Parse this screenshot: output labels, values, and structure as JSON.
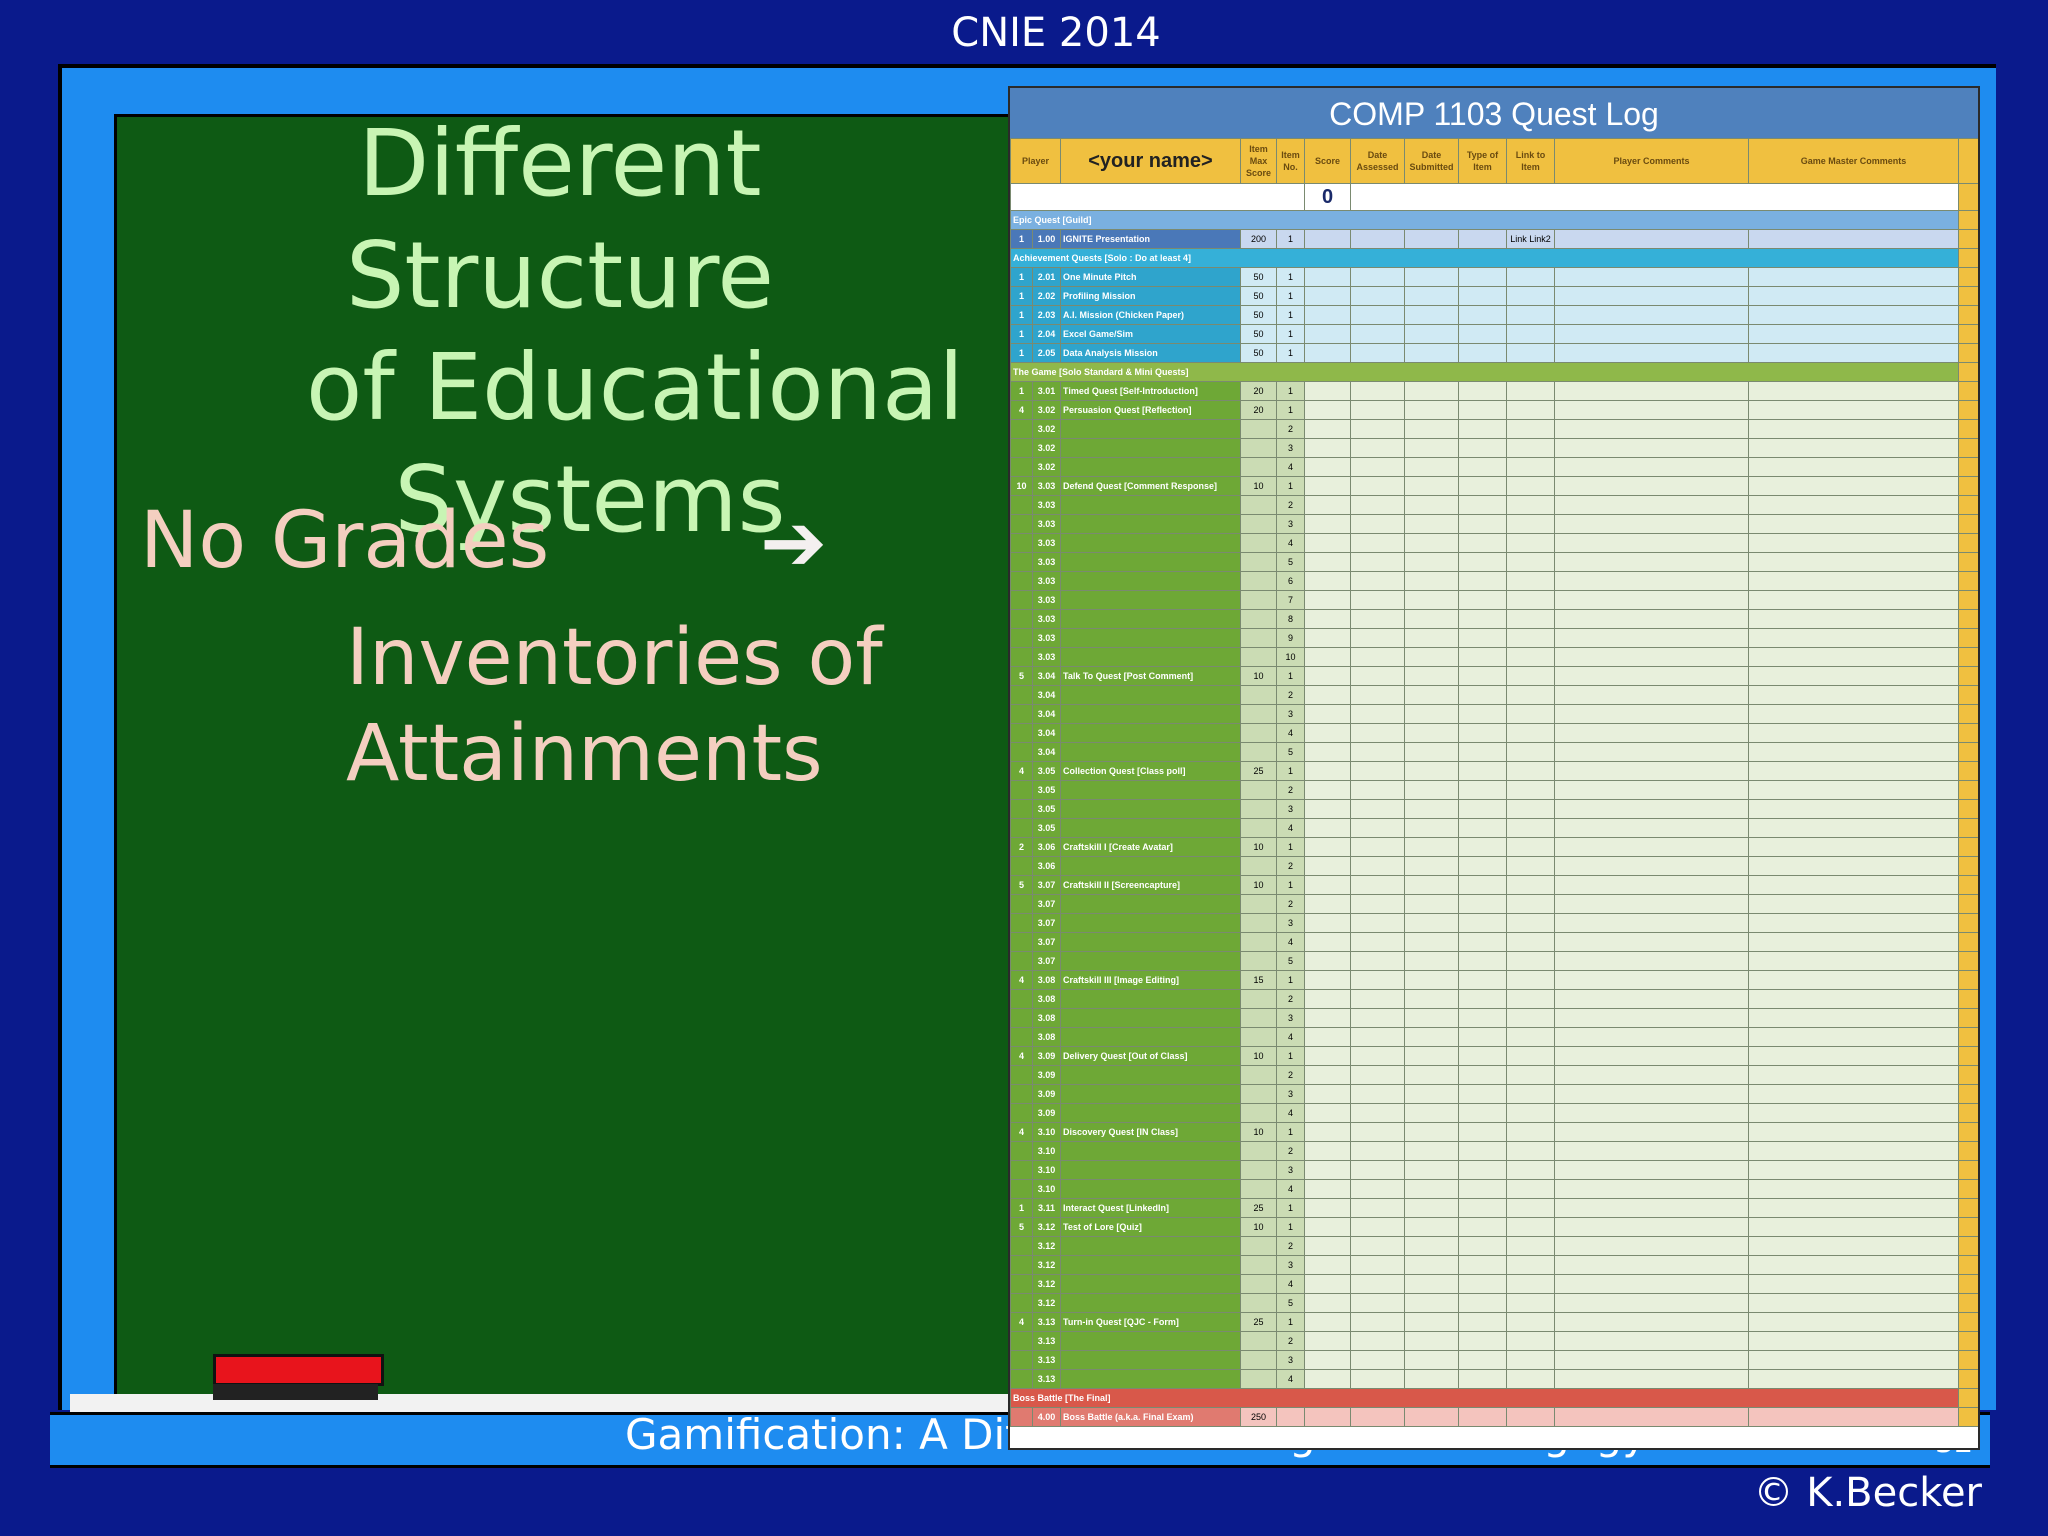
{
  "header": {
    "conference": "CNIE 2014"
  },
  "slide": {
    "title_line1": "Different Structure",
    "title_line2": "of Educational",
    "title_line3": "Systems",
    "left_text": "No Grades",
    "arrow_glyph": "➔",
    "right_text_line1": "Inventories of",
    "right_text_line2": "Attainments"
  },
  "footer": {
    "text": "Gamification: A Different Paradigm for Pedagogy",
    "page": "32",
    "copyright": "© K.Becker"
  },
  "sheet": {
    "title": "COMP 1103 Quest Log",
    "headers": [
      "Player",
      "<your name>",
      "Item Max Score",
      "Item No.",
      "Score",
      "Date Assessed",
      "Date Submitted",
      "Type of Item",
      "Link to Item",
      "Player Comments",
      "Game Master Comments"
    ],
    "score_total": "0",
    "sections": [
      {
        "title": "Epic Quest [Guild]",
        "style": "E",
        "rows": [
          {
            "p": "1",
            "id": "1.00",
            "name": "IGNITE Presentation",
            "max": "200",
            "no": "1",
            "link": "Link Link2"
          }
        ]
      },
      {
        "title": "Achievement Quests [Solo : Do at least 4]",
        "style": "A",
        "rows": [
          {
            "p": "1",
            "id": "2.01",
            "name": "One Minute Pitch",
            "max": "50",
            "no": "1"
          },
          {
            "p": "1",
            "id": "2.02",
            "name": "Profiling Mission",
            "max": "50",
            "no": "1"
          },
          {
            "p": "1",
            "id": "2.03",
            "name": "A.I. Mission (Chicken Paper)",
            "max": "50",
            "no": "1"
          },
          {
            "p": "1",
            "id": "2.04",
            "name": "Excel Game/Sim",
            "max": "50",
            "no": "1"
          },
          {
            "p": "1",
            "id": "2.05",
            "name": "Data Analysis Mission",
            "max": "50",
            "no": "1"
          }
        ]
      },
      {
        "title": "The Game [Solo Standard & Mini Quests]",
        "style": "G",
        "rows": [
          {
            "p": "1",
            "id": "3.01",
            "name": "Timed Quest [Self-Introduction]",
            "max": "20",
            "no": "1"
          },
          {
            "p": "4",
            "id": "3.02",
            "name": "Persuasion Quest [Reflection]",
            "max": "20",
            "no": "1"
          },
          {
            "p": "",
            "id": "3.02",
            "name": "",
            "max": "",
            "no": "2"
          },
          {
            "p": "",
            "id": "3.02",
            "name": "",
            "max": "",
            "no": "3"
          },
          {
            "p": "",
            "id": "3.02",
            "name": "",
            "max": "",
            "no": "4"
          },
          {
            "p": "10",
            "id": "3.03",
            "name": "Defend Quest [Comment Response]",
            "max": "10",
            "no": "1"
          },
          {
            "p": "",
            "id": "3.03",
            "name": "",
            "max": "",
            "no": "2"
          },
          {
            "p": "",
            "id": "3.03",
            "name": "",
            "max": "",
            "no": "3"
          },
          {
            "p": "",
            "id": "3.03",
            "name": "",
            "max": "",
            "no": "4"
          },
          {
            "p": "",
            "id": "3.03",
            "name": "",
            "max": "",
            "no": "5"
          },
          {
            "p": "",
            "id": "3.03",
            "name": "",
            "max": "",
            "no": "6"
          },
          {
            "p": "",
            "id": "3.03",
            "name": "",
            "max": "",
            "no": "7"
          },
          {
            "p": "",
            "id": "3.03",
            "name": "",
            "max": "",
            "no": "8"
          },
          {
            "p": "",
            "id": "3.03",
            "name": "",
            "max": "",
            "no": "9"
          },
          {
            "p": "",
            "id": "3.03",
            "name": "",
            "max": "",
            "no": "10"
          },
          {
            "p": "5",
            "id": "3.04",
            "name": "Talk To Quest [Post Comment]",
            "max": "10",
            "no": "1"
          },
          {
            "p": "",
            "id": "3.04",
            "name": "",
            "max": "",
            "no": "2"
          },
          {
            "p": "",
            "id": "3.04",
            "name": "",
            "max": "",
            "no": "3"
          },
          {
            "p": "",
            "id": "3.04",
            "name": "",
            "max": "",
            "no": "4"
          },
          {
            "p": "",
            "id": "3.04",
            "name": "",
            "max": "",
            "no": "5"
          },
          {
            "p": "4",
            "id": "3.05",
            "name": "Collection Quest [Class poll]",
            "max": "25",
            "no": "1"
          },
          {
            "p": "",
            "id": "3.05",
            "name": "",
            "max": "",
            "no": "2"
          },
          {
            "p": "",
            "id": "3.05",
            "name": "",
            "max": "",
            "no": "3"
          },
          {
            "p": "",
            "id": "3.05",
            "name": "",
            "max": "",
            "no": "4"
          },
          {
            "p": "2",
            "id": "3.06",
            "name": "Craftskill I [Create Avatar]",
            "max": "10",
            "no": "1"
          },
          {
            "p": "",
            "id": "3.06",
            "name": "",
            "max": "",
            "no": "2"
          },
          {
            "p": "5",
            "id": "3.07",
            "name": "Craftskill II [Screencapture]",
            "max": "10",
            "no": "1"
          },
          {
            "p": "",
            "id": "3.07",
            "name": "",
            "max": "",
            "no": "2"
          },
          {
            "p": "",
            "id": "3.07",
            "name": "",
            "max": "",
            "no": "3"
          },
          {
            "p": "",
            "id": "3.07",
            "name": "",
            "max": "",
            "no": "4"
          },
          {
            "p": "",
            "id": "3.07",
            "name": "",
            "max": "",
            "no": "5"
          },
          {
            "p": "4",
            "id": "3.08",
            "name": "Craftskill III [Image Editing]",
            "max": "15",
            "no": "1"
          },
          {
            "p": "",
            "id": "3.08",
            "name": "",
            "max": "",
            "no": "2"
          },
          {
            "p": "",
            "id": "3.08",
            "name": "",
            "max": "",
            "no": "3"
          },
          {
            "p": "",
            "id": "3.08",
            "name": "",
            "max": "",
            "no": "4"
          },
          {
            "p": "4",
            "id": "3.09",
            "name": "Delivery Quest [Out of Class]",
            "max": "10",
            "no": "1"
          },
          {
            "p": "",
            "id": "3.09",
            "name": "",
            "max": "",
            "no": "2"
          },
          {
            "p": "",
            "id": "3.09",
            "name": "",
            "max": "",
            "no": "3"
          },
          {
            "p": "",
            "id": "3.09",
            "name": "",
            "max": "",
            "no": "4"
          },
          {
            "p": "4",
            "id": "3.10",
            "name": "Discovery Quest [IN Class]",
            "max": "10",
            "no": "1"
          },
          {
            "p": "",
            "id": "3.10",
            "name": "",
            "max": "",
            "no": "2"
          },
          {
            "p": "",
            "id": "3.10",
            "name": "",
            "max": "",
            "no": "3"
          },
          {
            "p": "",
            "id": "3.10",
            "name": "",
            "max": "",
            "no": "4"
          },
          {
            "p": "1",
            "id": "3.11",
            "name": "Interact Quest [LinkedIn]",
            "max": "25",
            "no": "1"
          },
          {
            "p": "5",
            "id": "3.12",
            "name": "Test of Lore [Quiz]",
            "max": "10",
            "no": "1"
          },
          {
            "p": "",
            "id": "3.12",
            "name": "",
            "max": "",
            "no": "2"
          },
          {
            "p": "",
            "id": "3.12",
            "name": "",
            "max": "",
            "no": "3"
          },
          {
            "p": "",
            "id": "3.12",
            "name": "",
            "max": "",
            "no": "4"
          },
          {
            "p": "",
            "id": "3.12",
            "name": "",
            "max": "",
            "no": "5"
          },
          {
            "p": "4",
            "id": "3.13",
            "name": "Turn-in Quest [QJC - Form]",
            "max": "25",
            "no": "1"
          },
          {
            "p": "",
            "id": "3.13",
            "name": "",
            "max": "",
            "no": "2"
          },
          {
            "p": "",
            "id": "3.13",
            "name": "",
            "max": "",
            "no": "3"
          },
          {
            "p": "",
            "id": "3.13",
            "name": "",
            "max": "",
            "no": "4"
          }
        ]
      },
      {
        "title": "Boss Battle [The Final]",
        "style": "B",
        "rows": [
          {
            "p": "",
            "id": "4.00",
            "name": "Boss Battle (a.k.a. Final Exam)",
            "max": "250",
            "no": ""
          }
        ]
      }
    ]
  },
  "colors": {
    "background": "#0a1a8c",
    "frame": "#1e8cf0",
    "board": "#0e5a14",
    "header_row": "#f0c040",
    "sheet_title_bar": "#4f81bd"
  }
}
